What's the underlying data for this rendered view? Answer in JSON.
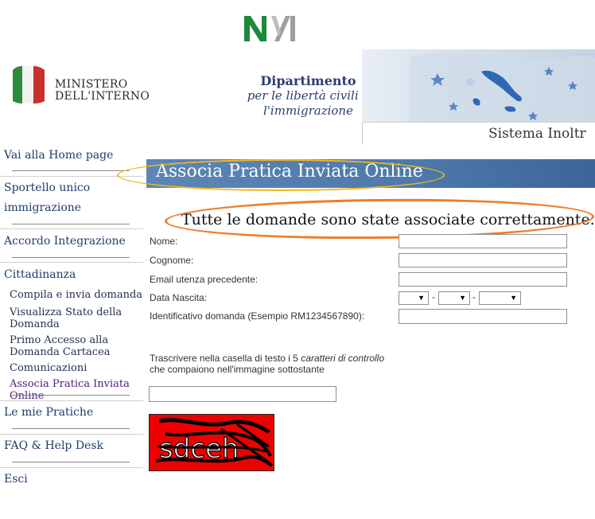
{
  "header": {
    "ministry_line1": "MINISTERO",
    "ministry_line2": "DELL'INTERNO",
    "dept_title": "Dipartimento",
    "dept_line2": "per le libertà civili e",
    "dept_line3": "l'immigrazione",
    "system_label": "Sistema Inoltr"
  },
  "sidebar": {
    "home": "Vai alla Home page",
    "sportello_1": "Sportello unico",
    "sportello_2": "immigrazione",
    "accordo": "Accordo Integrazione",
    "cittadinanza": "Cittadinanza",
    "sub": {
      "compila": "Compila e invia domanda",
      "visualizza": "Visualizza Stato della Domanda",
      "primo": "Primo Accesso alla Domanda Cartacea",
      "comunicazioni": "Comunicazioni",
      "associa": "Associa Pratica Inviata Online"
    },
    "pratiche": "Le mie Pratiche",
    "faq": "FAQ & Help Desk",
    "esci": "Esci"
  },
  "page": {
    "title": "Associa Pratica Inviata Online",
    "success_message": "Tutte le domande sono state associate correttamente."
  },
  "form": {
    "nome_label": "Nome:",
    "cognome_label": "Cognome:",
    "email_label": "Email utenza precedente:",
    "data_label": "Data Nascita:",
    "id_label": "Identificativo domanda (Esempio RM1234567890):",
    "date_sep": "-",
    "captcha_instr_pre": "Trascrivere nella casella di testo i 5 ",
    "captcha_instr_em": "caratteri di controllo",
    "captcha_instr_post": "che compaiono nell'immagine sottostante",
    "captcha_text": "sdceh"
  },
  "colors": {
    "title_bar": "#4e79ab",
    "title_highlight": "#f3b51c",
    "message_highlight": "#ef7c2a",
    "captcha_bg": "#ee0000",
    "nav_link": "#1f3c6b"
  }
}
